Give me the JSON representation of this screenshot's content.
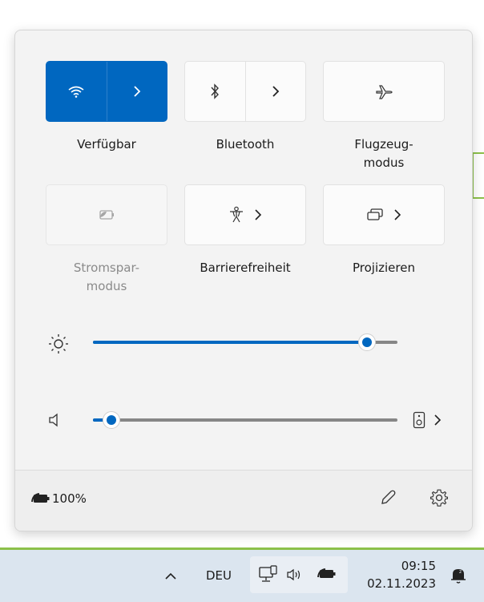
{
  "tiles": {
    "wifi": {
      "label": "Verfügbar",
      "icon": "wifi-icon",
      "state": "on"
    },
    "bluetooth": {
      "label": "Bluetooth",
      "icon": "bluetooth-icon",
      "state": "off"
    },
    "airplane": {
      "label": "Flugzeug-\nmodus",
      "label_line1": "Flugzeug-",
      "label_line2": "modus",
      "icon": "airplane-icon",
      "state": "off"
    },
    "battery_saver": {
      "label_line1": "Stromspar-",
      "label_line2": "modus",
      "icon": "battery-saver-icon",
      "state": "disabled"
    },
    "accessibility": {
      "label": "Barrierefreiheit",
      "icon": "accessibility-icon",
      "state": "off"
    },
    "project": {
      "label": "Projizieren",
      "icon": "project-icon",
      "state": "off"
    }
  },
  "brightness": {
    "icon": "brightness-icon",
    "value_fraction": 0.9
  },
  "volume": {
    "icon": "speaker-icon",
    "value_fraction": 0.06,
    "output_icon": "speaker-device-icon"
  },
  "footer": {
    "battery_percent": "100%",
    "battery_icon": "battery-charging-icon",
    "edit_icon": "pencil-icon",
    "settings_icon": "gear-icon"
  },
  "taskbar": {
    "language": "DEU",
    "time": "09:15",
    "date": "02.11.2023",
    "chevron_icon": "chevron-up-icon",
    "tray_icons": [
      "network-icon",
      "volume-icon",
      "battery-icon"
    ],
    "notification_icon": "notification-icon"
  },
  "colors": {
    "accent": "#0067c0",
    "taskbar_border": "#8cc04a"
  }
}
